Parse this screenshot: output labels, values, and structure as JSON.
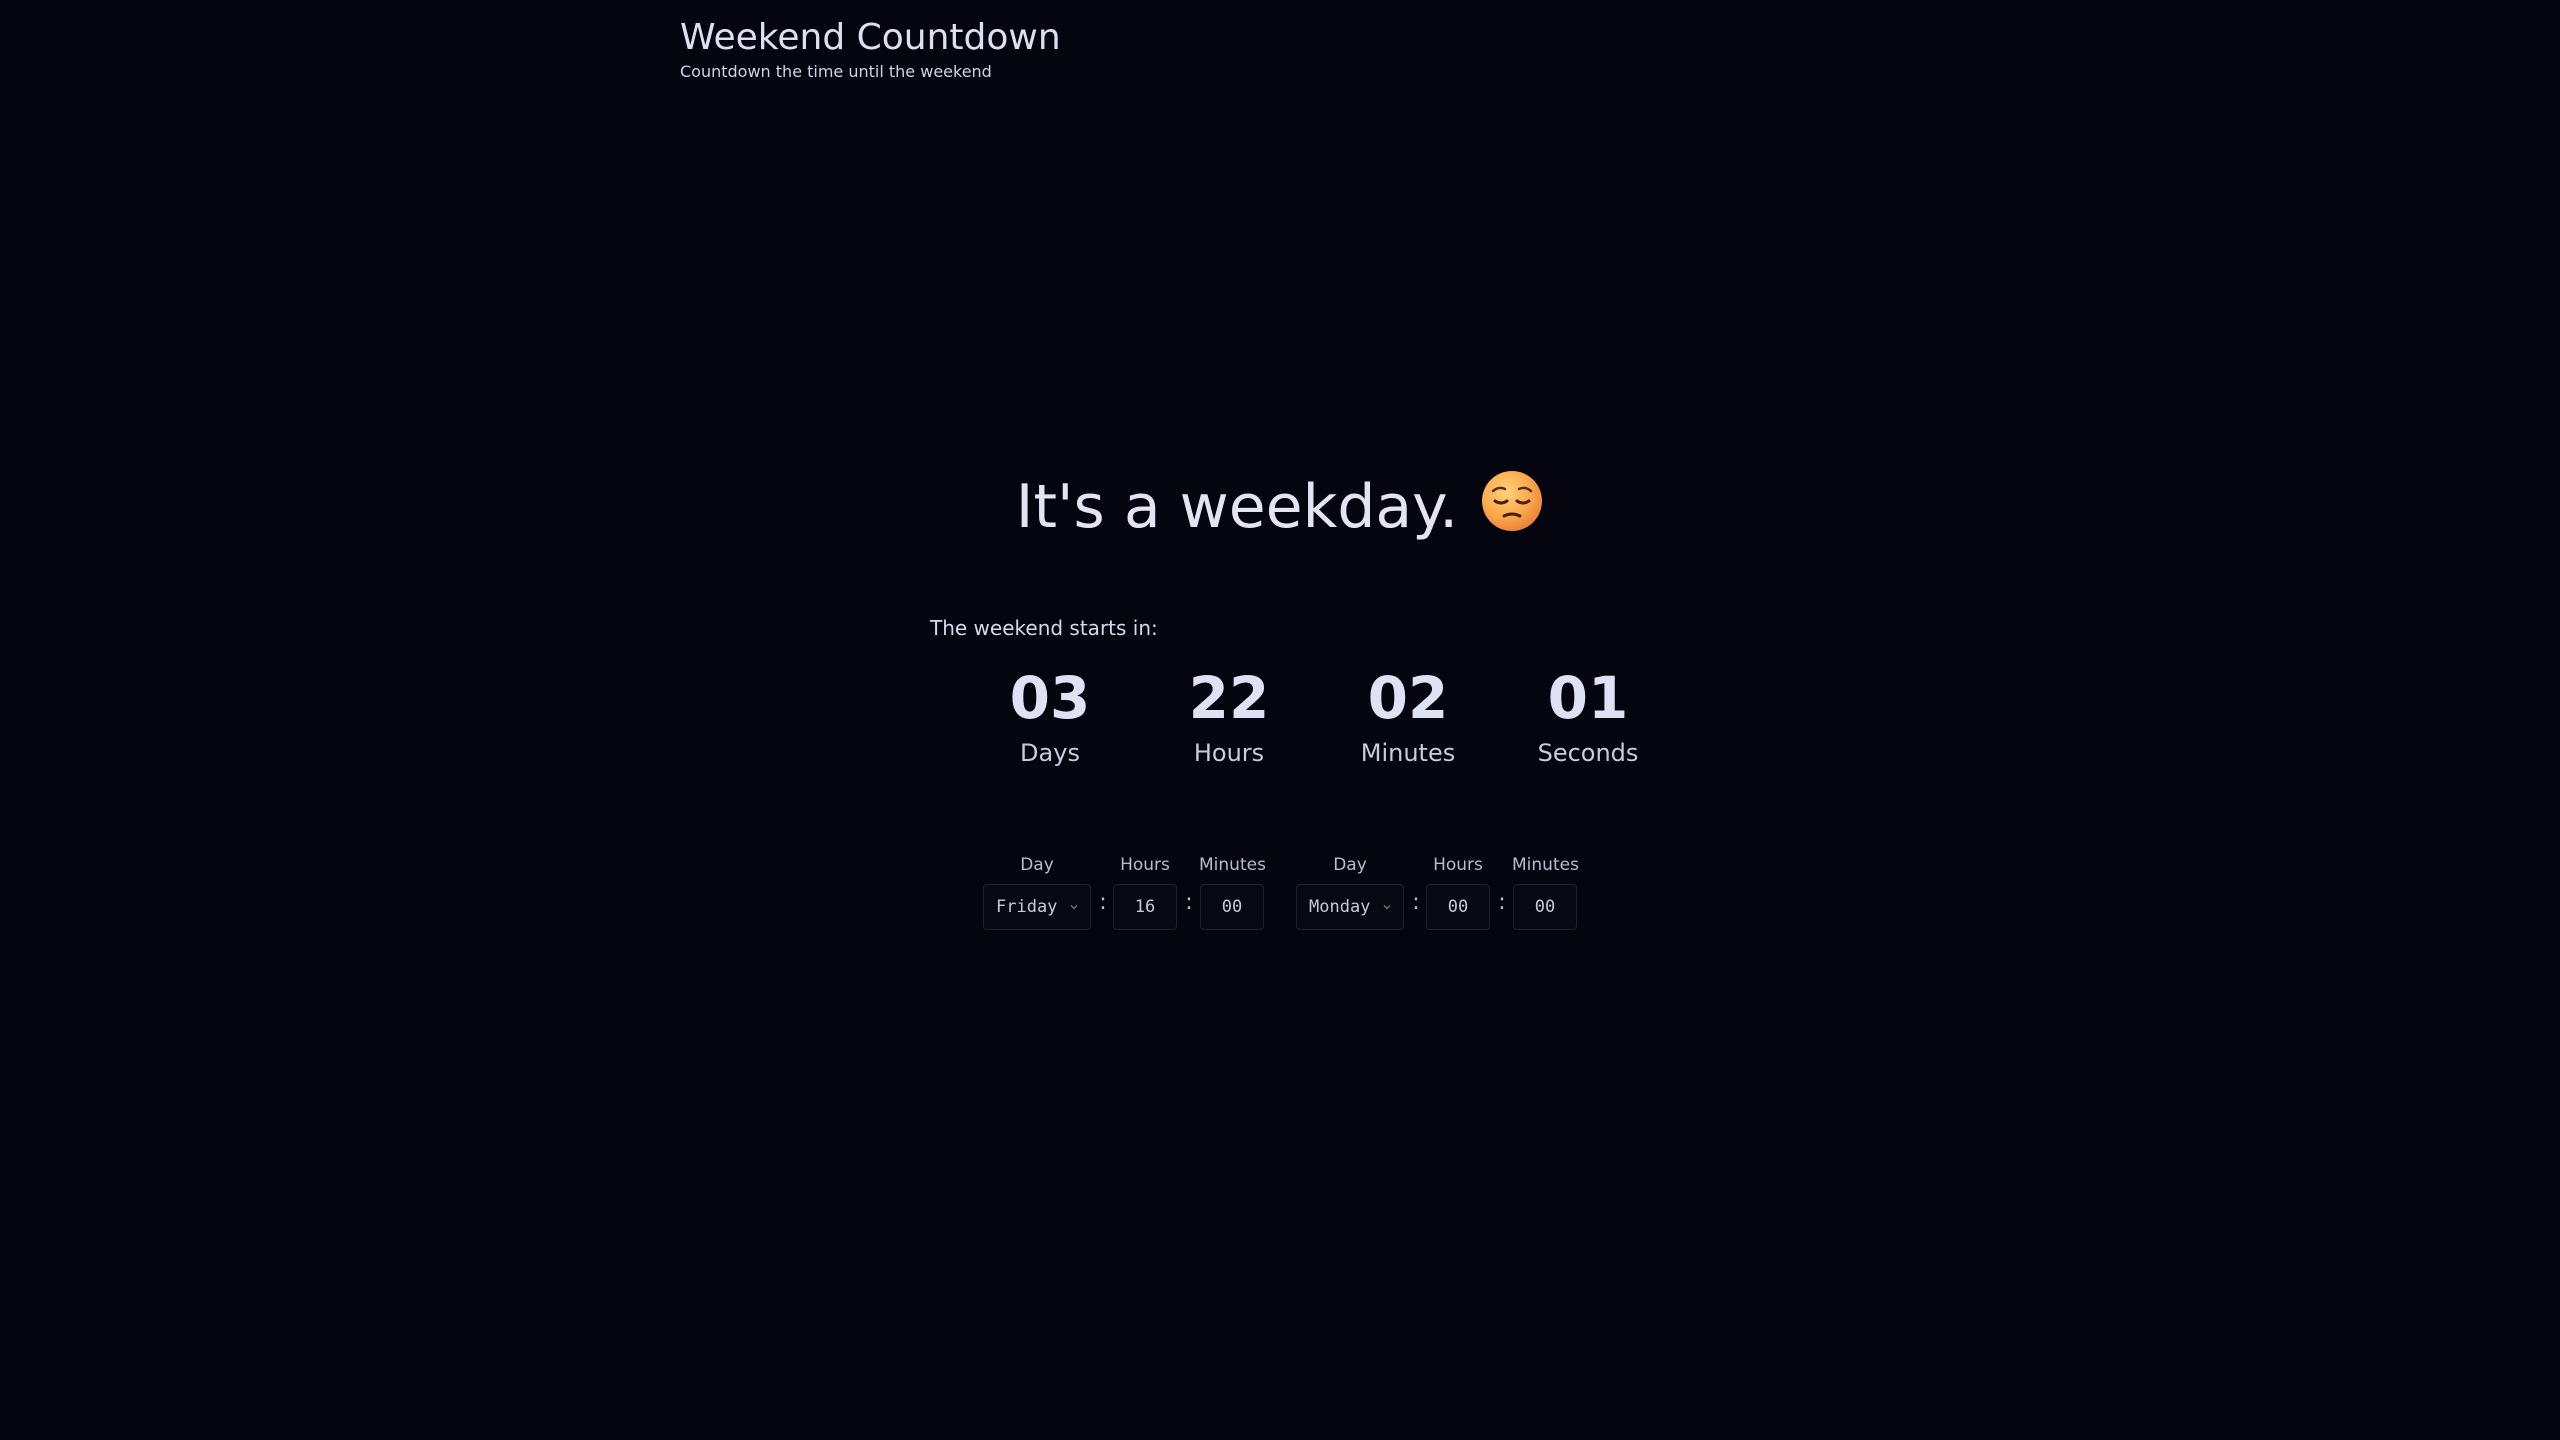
{
  "header": {
    "title": "Weekend Countdown",
    "subtitle": "Countdown the time until the weekend"
  },
  "status": {
    "message": "It's a weekday.",
    "emoji_icon": "pensive-face-icon"
  },
  "countdown": {
    "label": "The weekend starts in:",
    "units": [
      {
        "value": "03",
        "label": "Days"
      },
      {
        "value": "22",
        "label": "Hours"
      },
      {
        "value": "02",
        "label": "Minutes"
      },
      {
        "value": "01",
        "label": "Seconds"
      }
    ]
  },
  "weekend_start": {
    "day_label": "Day",
    "day_value": "Friday",
    "hours_label": "Hours",
    "hours_value": "16",
    "minutes_label": "Minutes",
    "minutes_value": "00"
  },
  "weekend_end": {
    "day_label": "Day",
    "day_value": "Monday",
    "hours_label": "Hours",
    "hours_value": "00",
    "minutes_label": "Minutes",
    "minutes_value": "00"
  },
  "separator": ":",
  "colors": {
    "background": "#05050f",
    "text": "#dde0f2",
    "field_border": "#1e2030"
  }
}
